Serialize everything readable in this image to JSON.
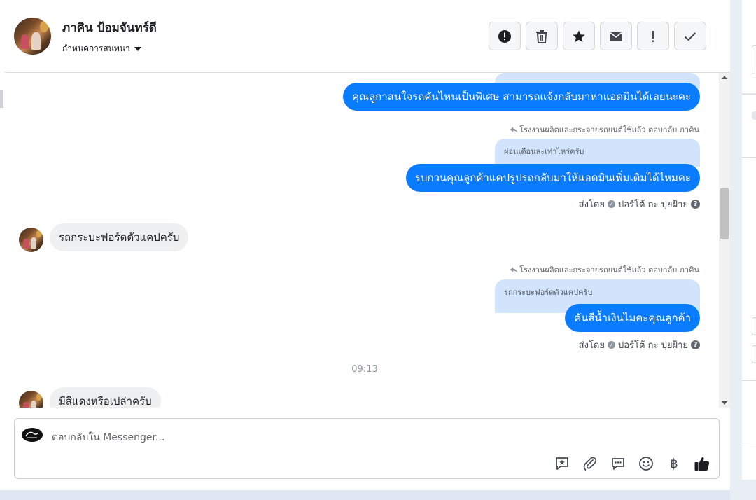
{
  "header": {
    "contact_name": "ภาคิน ป้อมจันทร์ดี",
    "assign_label": "กำหนดการสนทนา"
  },
  "actions": [
    {
      "name": "spam-button",
      "icon": "alert-circle-icon"
    },
    {
      "name": "delete-button",
      "icon": "trash-icon"
    },
    {
      "name": "star-button",
      "icon": "star-icon"
    },
    {
      "name": "mark-unread-button",
      "icon": "envelope-icon"
    },
    {
      "name": "follow-up-button",
      "icon": "exclamation-icon"
    },
    {
      "name": "mark-done-button",
      "icon": "checkmark-icon"
    }
  ],
  "messages": {
    "m1_text": "คุณลูกาสนใจรถคันไหนเป็นพิเศษ สามารถแจ้งกลับมาหาแอดมินได้เลยนะคะ",
    "m2_reply_meta": "โรงงานผลิตและกระจายรถยนต์ใช้แล้ว ตอบกลับ ภาคิน",
    "m2_quote": "ผ่อนเดือนละเท่าไหร่ครับ",
    "m2_text": "รบกวนคุณลูกค้าแคปรูปรถกลับมาให้แอดมินเพิ่มเติมได้ไหมคะ",
    "sent_by_prefix": "ส่งโดย",
    "sender_name": "ปอร์โต้ กะ ปุยฝ้าย",
    "m3_text": "รถกระบะฟอร์ดตัวแคปครับ",
    "m4_reply_meta": "โรงงานผลิตและกระจายรถยนต์ใช้แล้ว ตอบกลับ ภาคิน",
    "m4_quote": "รถกระบะฟอร์ดตัวแคปครับ",
    "m4_text": "คันสีน้ำเงินไมคะคุณลูกค้า",
    "time": "09:13",
    "m5_text": "มีสีแดงหรือเปล่าครับ"
  },
  "composer": {
    "placeholder": "ตอบกลับใน Messenger...",
    "tools": [
      "saved-reply-icon",
      "attachment-icon",
      "chat-bubble-icon",
      "emoji-icon",
      "baht-icon",
      "thumbs-up-icon"
    ],
    "baht_glyph": "฿"
  },
  "colors": {
    "outgoing": "#0a7cff",
    "quote": "#d2e3fc",
    "incoming": "#eff0f2"
  }
}
